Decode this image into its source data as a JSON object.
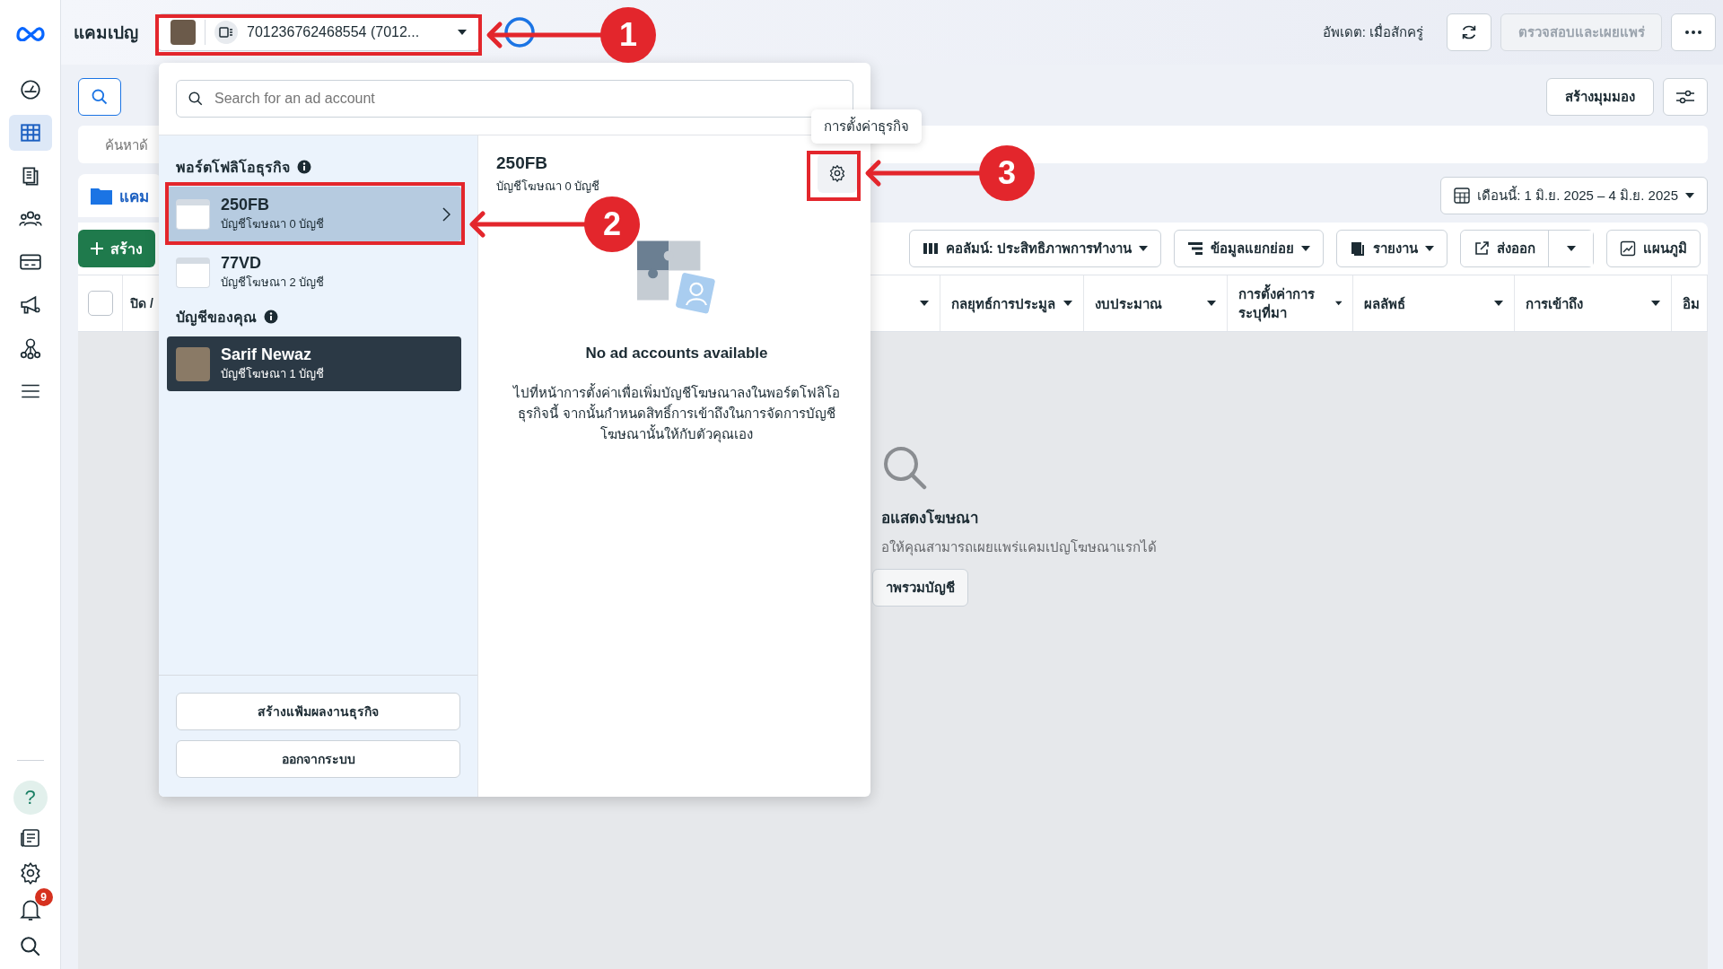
{
  "sidebar": {
    "nav": [
      {
        "kind": "gauge",
        "selected": false
      },
      {
        "kind": "table",
        "selected": true
      },
      {
        "kind": "pages",
        "selected": false
      },
      {
        "kind": "people",
        "selected": false
      },
      {
        "kind": "card",
        "selected": false
      },
      {
        "kind": "megaphone",
        "selected": false
      },
      {
        "kind": "network",
        "selected": false
      },
      {
        "kind": "menu",
        "selected": false
      }
    ],
    "help": "?",
    "notifications_badge": "9"
  },
  "topbar": {
    "title": "แคมเปญ",
    "account_selector": "701236762468554 (7012...",
    "updated": "อัพเดต: เมื่อสักครู่",
    "publish_button": {
      "label": "ตรวจสอบและเผยแพร่",
      "disabled": true
    }
  },
  "toolbar": {
    "create_view": "สร้างมุมมอง",
    "search_placeholder": "ค้นหาด้",
    "tab": "แคม",
    "date_range": "เดือนนี้: 1 มิ.ย. 2025 – 4 มิ.ย. 2025",
    "create_button": "สร้าง",
    "actions": [
      {
        "kind": "columns",
        "label": "คอลัมน์: ประสิทธิภาพการทำงาน"
      },
      {
        "kind": "breakdown",
        "label": "ข้อมูลแยกย่อย"
      },
      {
        "kind": "reports",
        "label": "รายงาน"
      },
      {
        "kind": "export",
        "label": "ส่งออก"
      },
      {
        "kind": "chart",
        "label": "แผนภูมิ"
      }
    ]
  },
  "table": {
    "select_all": {
      "checked": false
    },
    "first_column": "ปิด /",
    "columns": [
      "กลยุทธ์การประมูล",
      "งบประมาณ",
      "การตั้งค่าการระบุที่มา",
      "ผลลัพธ์",
      "การเข้าถึง",
      "อิม"
    ]
  },
  "empty_state": {
    "title": "อแสดงโฆษณา",
    "subtitle": "อให้คุณสามารถเผยแพร่แคมเปญโฆษณาแรกได้",
    "button": "าพรวมบัญชี"
  },
  "popup": {
    "search_placeholder": "Search for an ad account",
    "portfolios_heading": "พอร์ตโฟลิโอธุรกิจ",
    "portfolios": [
      {
        "name": "250FB",
        "subtitle": "บัญชีโฆษณา 0 บัญชี",
        "selected": true
      },
      {
        "name": "77VD",
        "subtitle": "บัญชีโฆษณา 2 บัญชี",
        "selected": false
      }
    ],
    "accounts_heading": "บัญชีของคุณ",
    "accounts": [
      {
        "name": "Sarif Newaz",
        "subtitle": "บัญชีโฆษณา 1 บัญชี",
        "current": true
      }
    ],
    "footer_buttons": [
      "สร้างแฟ้มผลงานธุรกิจ",
      "ออกจากระบบ"
    ],
    "detail": {
      "name": "250FB",
      "subtitle": "บัญชีโฆษณา 0 บัญชี",
      "empty_title": "No ad accounts available",
      "empty_text": "ไปที่หน้าการตั้งค่าเพื่อเพิ่มบัญชีโฆษณาลงในพอร์ตโฟลิโอธุรกิจนี้ จากนั้นกำหนดสิทธิ์การเข้าถึงในการจัดการบัญชีโฆษณานั้นให้กับตัวคุณเอง"
    },
    "tooltip": "การตั้งค่าธุรกิจ"
  },
  "callouts": [
    "1",
    "2",
    "3"
  ]
}
